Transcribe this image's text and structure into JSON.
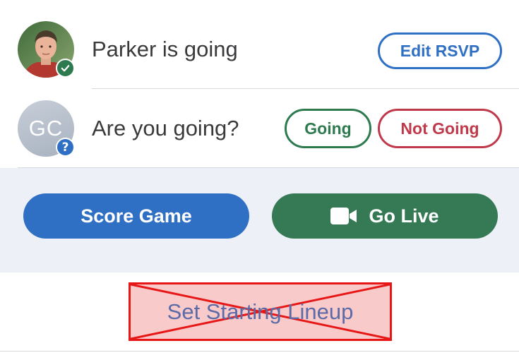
{
  "rsvp": {
    "current_player": {
      "avatar_icon": "player-photo",
      "status_icon": "check-icon",
      "status_text": "Parker is going",
      "edit_label": "Edit RSVP"
    },
    "viewer": {
      "initials": "GC",
      "status_icon": "question-icon",
      "question_text": "Are you going?",
      "going_label": "Going",
      "not_going_label": "Not Going"
    }
  },
  "actions": {
    "score_label": "Score Game",
    "live_label": "Go Live",
    "live_icon": "video-camera-icon"
  },
  "lineup": {
    "label": "Set Starting Lineup"
  },
  "colors": {
    "primary_blue": "#2f6fc4",
    "success_green": "#2e7a4f",
    "danger_red": "#c0394b",
    "band_background": "#edf1f7"
  }
}
